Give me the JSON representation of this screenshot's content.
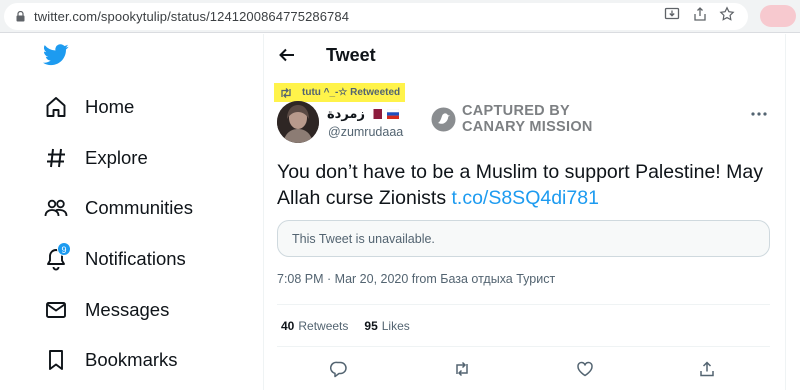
{
  "browser": {
    "url": "twitter.com/spookytulip/status/1241200864775286784",
    "icons": [
      "lock-icon",
      "install-app-icon",
      "share-icon",
      "star-icon"
    ]
  },
  "sidebar": {
    "logo": "twitter-bird-icon",
    "items": [
      {
        "label": "Home",
        "icon": "home-icon"
      },
      {
        "label": "Explore",
        "icon": "hashtag-icon"
      },
      {
        "label": "Communities",
        "icon": "communities-icon"
      },
      {
        "label": "Notifications",
        "icon": "bell-icon",
        "badge": "9"
      },
      {
        "label": "Messages",
        "icon": "envelope-icon"
      },
      {
        "label": "Bookmarks",
        "icon": "bookmark-icon"
      }
    ]
  },
  "main": {
    "header_title": "Tweet",
    "retweet_label": "tutu ^_-☆ Retweeted",
    "author": {
      "display_name": "زمردة",
      "handle": "@zumrudaaa",
      "flags": [
        "qatar-flag",
        "russia-flag"
      ]
    },
    "watermark": {
      "line1": "CAPTURED BY",
      "line2": "CANARY MISSION"
    },
    "tweet": {
      "text": "You don’t have to be a Muslim to support Palestine! May Allah curse Zionists ",
      "link": "t.co/S8SQ4di781"
    },
    "quote_unavailable": "This Tweet is unavailable.",
    "meta": "7:08 PM · Mar 20, 2020 from База отдыха Турист",
    "stats": {
      "retweets_count": "40",
      "retweets_label": "Retweets",
      "likes_count": "95",
      "likes_label": "Likes"
    },
    "actions": [
      "reply-icon",
      "retweet-icon",
      "like-icon",
      "share-icon"
    ]
  },
  "colors": {
    "accent": "#1d9bf0",
    "highlight": "#fff34a",
    "text": "#0f1419",
    "secondary": "#536471"
  }
}
